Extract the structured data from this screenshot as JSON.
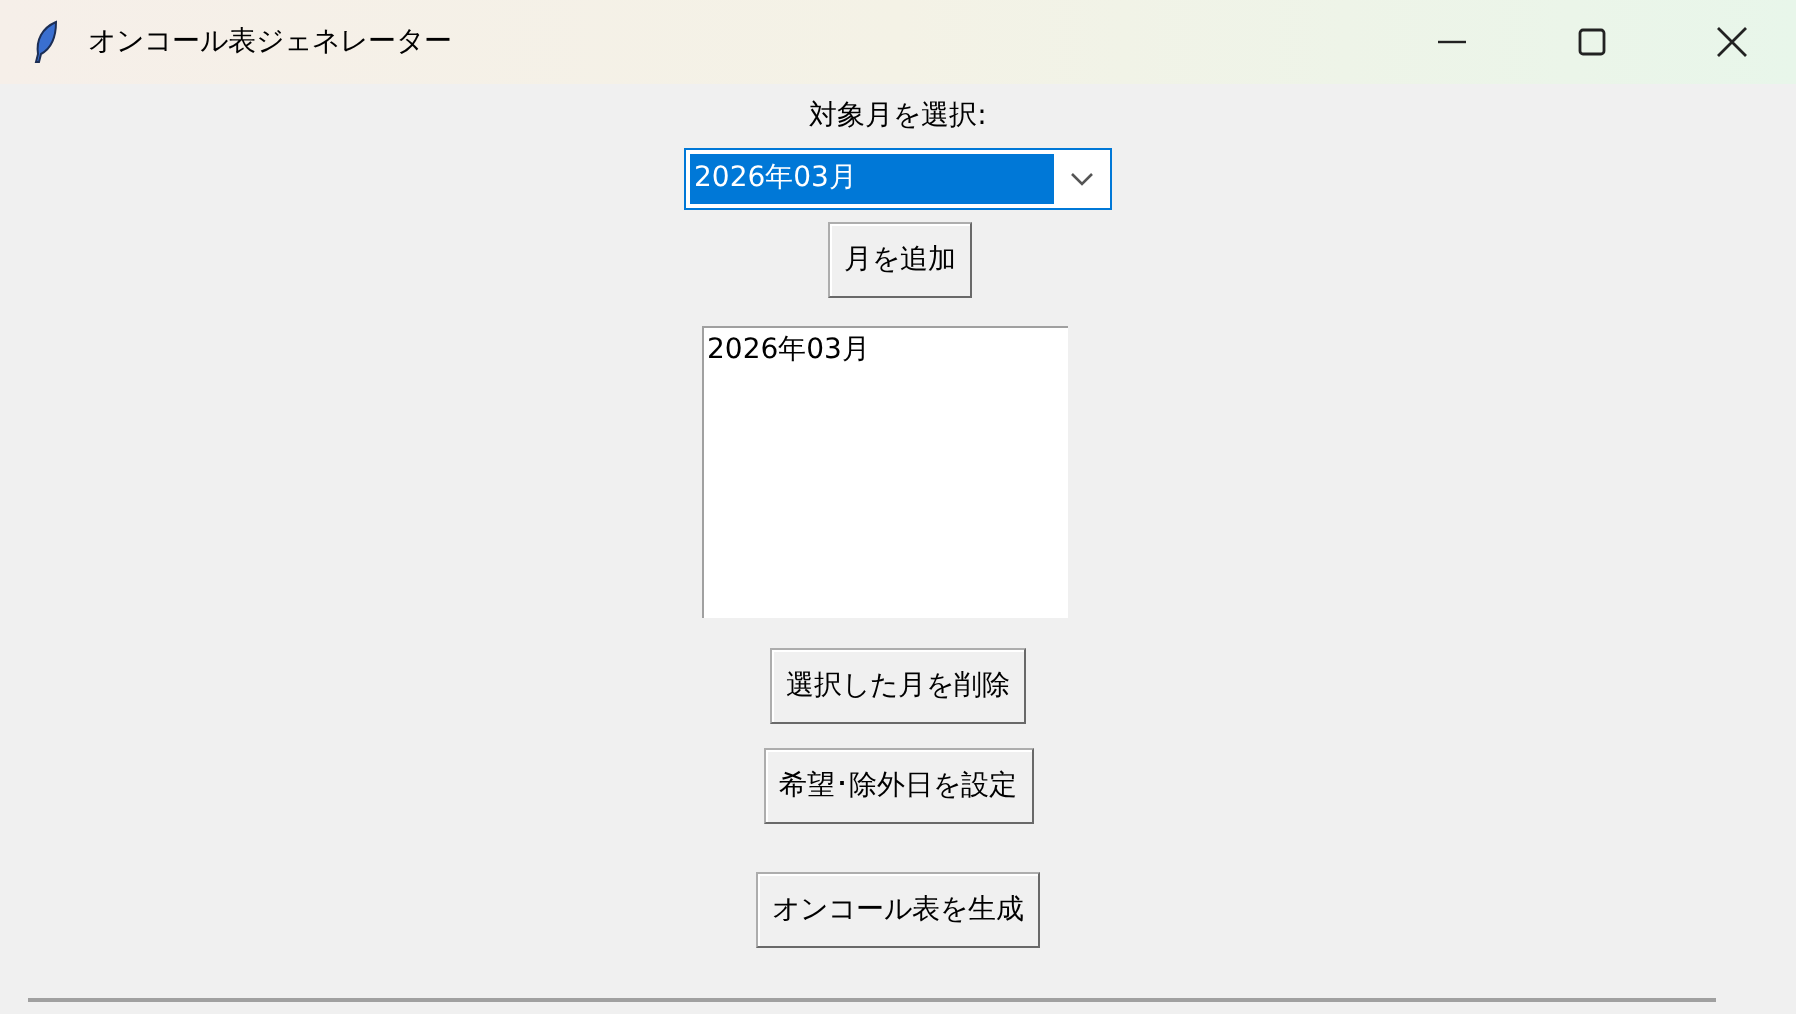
{
  "window": {
    "title": "オンコール表ジェネレーター"
  },
  "month_label": "対象月を選択:",
  "month_combo": {
    "value": "2026年03月"
  },
  "add_button": "月を追加",
  "month_list": [
    {
      "label": "2026年03月",
      "selected": false
    }
  ],
  "buttons": [
    "選択した月を削除",
    "希望･除外日を設定",
    "オンコール表を生成"
  ]
}
